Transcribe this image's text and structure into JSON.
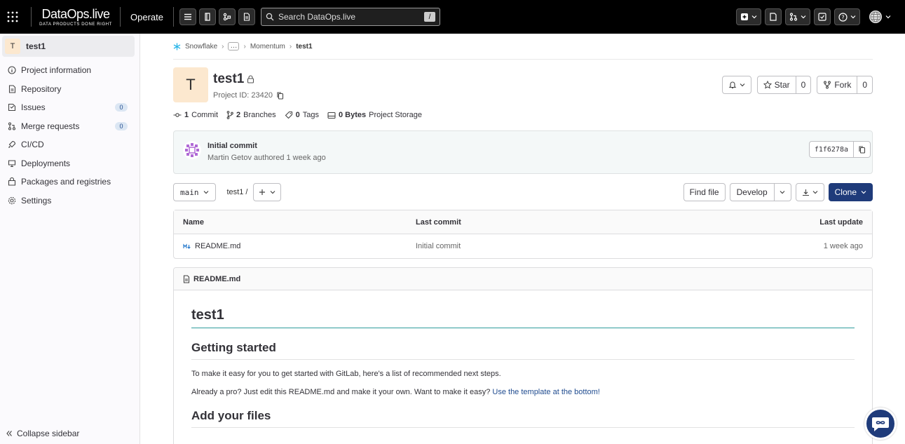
{
  "topbar": {
    "logo_wordmark": "DataOps.live",
    "logo_tagline": "DATA PRODUCTS DONE RIGHT",
    "operate_label": "Operate",
    "search_placeholder": "Search DataOps.live",
    "search_shortcut": "/"
  },
  "sidebar": {
    "project_initial": "T",
    "project_name": "test1",
    "items": [
      {
        "label": "Project information",
        "icon": "info-icon"
      },
      {
        "label": "Repository",
        "icon": "document-icon"
      },
      {
        "label": "Issues",
        "icon": "issues-icon",
        "badge": "0"
      },
      {
        "label": "Merge requests",
        "icon": "merge-request-icon",
        "badge": "0"
      },
      {
        "label": "CI/CD",
        "icon": "rocket-icon"
      },
      {
        "label": "Deployments",
        "icon": "deployments-icon"
      },
      {
        "label": "Packages and registries",
        "icon": "package-icon"
      },
      {
        "label": "Settings",
        "icon": "gear-icon"
      }
    ],
    "collapse_label": "Collapse sidebar"
  },
  "breadcrumb": {
    "group": "Snowflake",
    "subgroup": "Momentum",
    "current": "test1"
  },
  "project": {
    "initial": "T",
    "name": "test1",
    "id_text": "Project ID: 23420",
    "star_label": "Star",
    "star_count": "0",
    "fork_label": "Fork",
    "fork_count": "0",
    "stats": {
      "commits_num": "1",
      "commits_label": "Commit",
      "branches_num": "2",
      "branches_label": "Branches",
      "tags_num": "0",
      "tags_label": "Tags",
      "storage_num": "0 Bytes",
      "storage_label": "Project Storage"
    }
  },
  "last_commit": {
    "title": "Initial commit",
    "meta": "Martin Getov authored 1 week ago",
    "sha": "f1f6278a"
  },
  "toolbar": {
    "branch": "main",
    "path": "test1",
    "path_sep": "/",
    "find_file": "Find file",
    "develop": "Develop",
    "clone": "Clone"
  },
  "files": {
    "headers": {
      "name": "Name",
      "last_commit": "Last commit",
      "last_update": "Last update"
    },
    "rows": [
      {
        "name": "README.md",
        "last_commit": "Initial commit",
        "last_update": "1 week ago"
      }
    ]
  },
  "readme": {
    "file_name": "README.md",
    "h1": "test1",
    "h2_getting_started": "Getting started",
    "p1": "To make it easy for you to get started with GitLab, here's a list of recommended next steps.",
    "p2_text": "Already a pro? Just edit this README.md and make it your own. Want to make it easy? ",
    "p2_link": "Use the template at the bottom!",
    "h2_add_files": "Add your files"
  },
  "colors": {
    "topbar_bg": "#000000",
    "primary_button": "#1f3b7a",
    "avatar_bg": "#fce8cf"
  }
}
